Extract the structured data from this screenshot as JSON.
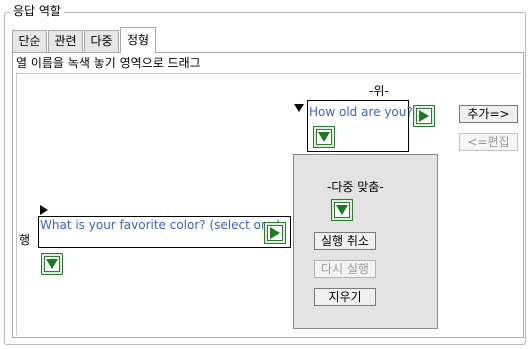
{
  "group": {
    "title": "응답 역할"
  },
  "tabs": [
    {
      "label": "단순"
    },
    {
      "label": "관련"
    },
    {
      "label": "다중"
    },
    {
      "label": "정형",
      "active": true
    }
  ],
  "instructions": "열 이름을 녹색 놓기 영역으로 드래그",
  "top_area": {
    "label": "-위-",
    "column_name": "How old are you?"
  },
  "side_area": {
    "label": "행",
    "column_name": "What is your favorite color? (select one)"
  },
  "center_area": {
    "label": "-다중 맞춤-"
  },
  "buttons": {
    "add": "추가=>",
    "edit": "<=편집",
    "undo": "실행 취소",
    "redo": "다시 실행",
    "clear": "지우기"
  },
  "colors": {
    "accent_green": "#1f7a1f",
    "link_blue": "#3a63c8"
  }
}
